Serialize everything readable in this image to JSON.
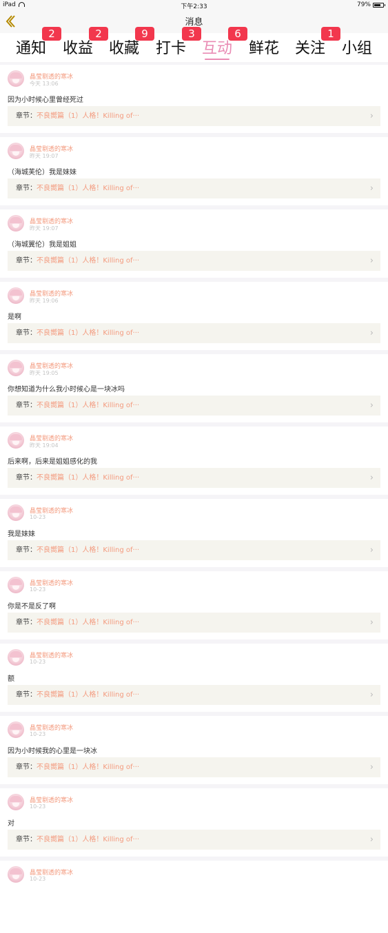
{
  "statusbar": {
    "device": "iPad",
    "time": "下午2:33",
    "battery": "79%",
    "battery_level": 0.79
  },
  "navbar": {
    "title": "消息"
  },
  "tabs": [
    {
      "label": "通知",
      "badge": "2"
    },
    {
      "label": "收益",
      "badge": "2"
    },
    {
      "label": "收藏",
      "badge": "9"
    },
    {
      "label": "打卡",
      "badge": "3"
    },
    {
      "label": "互动",
      "badge": "6",
      "active": true
    },
    {
      "label": "鲜花",
      "badge": ""
    },
    {
      "label": "关注",
      "badge": "1"
    },
    {
      "label": "小组",
      "badge": ""
    }
  ],
  "colors": {
    "accent_pink": "#e98bb4",
    "badge_red": "#f2374d",
    "name_orange": "#f39a7e",
    "chapter_bg": "#f5f4ee"
  },
  "chapter_label": "章节：",
  "items": [
    {
      "user": "晶莹剔透的寒冰",
      "time": "今天 13:06",
      "message": "因为小时候心里曾经死过",
      "chapter": "不良嚮篇（1）人格！Killing of···"
    },
    {
      "user": "晶莹剔透的寒冰",
      "time": "昨天 19:07",
      "message": "（海城芙伦）我是妹妹",
      "chapter": "不良嚮篇（1）人格！Killing of···"
    },
    {
      "user": "晶莹剔透的寒冰",
      "time": "昨天 19:07",
      "message": "（海城翼伦）我是姐姐",
      "chapter": "不良嚮篇（1）人格！Killing of···"
    },
    {
      "user": "晶莹剔透的寒冰",
      "time": "昨天 19:06",
      "message": "是啊",
      "chapter": "不良嚮篇（1）人格！Killing of···"
    },
    {
      "user": "晶莹剔透的寒冰",
      "time": "昨天 19:05",
      "message": "你想知道为什么我小时候心是一块冰吗",
      "chapter": "不良嚮篇（1）人格！Killing of···"
    },
    {
      "user": "晶莹剔透的寒冰",
      "time": "昨天 19:04",
      "message": "后来啊，后来是姐姐感化的我",
      "chapter": "不良嚮篇（1）人格！Killing of···"
    },
    {
      "user": "晶莹剔透的寒冰",
      "time": "10-23",
      "message": "我是妹妹",
      "chapter": "不良嚮篇（1）人格！Killing of···"
    },
    {
      "user": "晶莹剔透的寒冰",
      "time": "10-23",
      "message": "你是不是反了啊",
      "chapter": "不良嚮篇（1）人格！Killing of···"
    },
    {
      "user": "晶莹剔透的寒冰",
      "time": "10-23",
      "message": "额",
      "chapter": "不良嚮篇（1）人格！Killing of···"
    },
    {
      "user": "晶莹剔透的寒冰",
      "time": "10-23",
      "message": "因为小时候我的心里是一块冰",
      "chapter": "不良嚮篇（1）人格！Killing of···"
    },
    {
      "user": "晶莹剔透的寒冰",
      "time": "10-23",
      "message": "对",
      "chapter": "不良嚮篇（1）人格！Killing of···"
    },
    {
      "user": "晶莹剔透的寒冰",
      "time": "10-23",
      "message": "",
      "chapter": ""
    }
  ]
}
